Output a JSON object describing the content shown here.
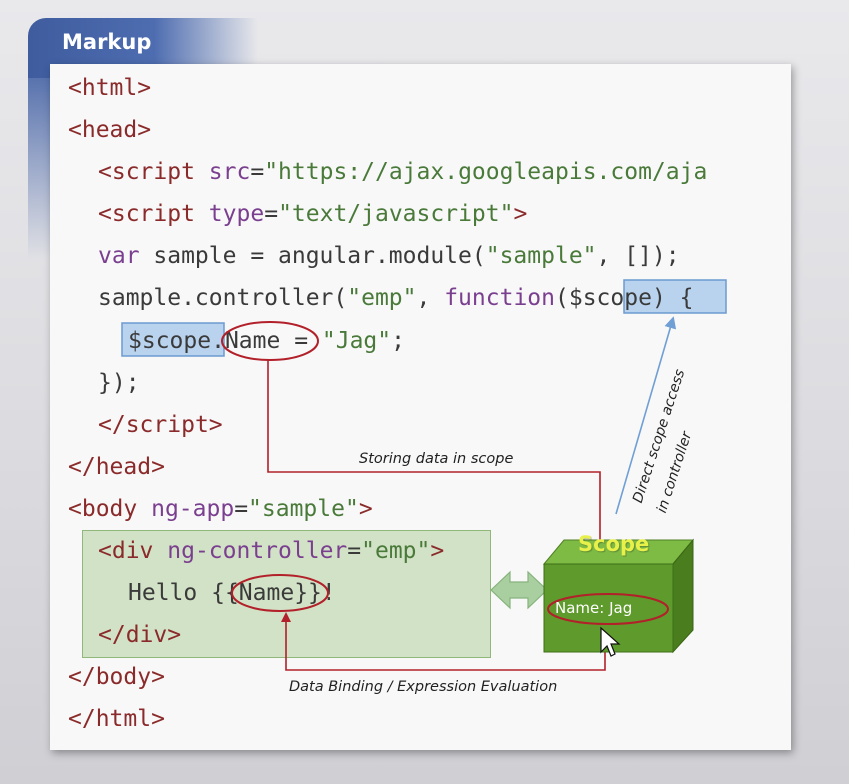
{
  "header": {
    "title": "Markup"
  },
  "code": {
    "l1": {
      "open": "<",
      "tag": "html",
      "close": ">"
    },
    "l2": {
      "open": "<",
      "tag": "head",
      "close": ">"
    },
    "l3": {
      "open": "<",
      "tag": "script",
      "attr": " src",
      "eq": "=",
      "val": "\"https://ajax.googleapis.com/aja"
    },
    "l4": {
      "open": "<",
      "tag": "script",
      "attr": " type",
      "eq": "=",
      "val": "\"text/javascript\"",
      "close": ">"
    },
    "l5": {
      "kw": "var",
      "rest1": " sample = angular.module(",
      "str": "\"sample\"",
      "rest2": ", []);"
    },
    "l6": {
      "a": "sample.controller(",
      "str": "\"emp\"",
      "b": ", ",
      "kw": "function",
      "c": "(",
      "param": "$scope",
      "d": ") {"
    },
    "l7": {
      "scope": "$scope",
      "dot": ".",
      "prop": "Name",
      "eq": " = ",
      "str": "\"Jag\"",
      "end": ";"
    },
    "l8": {
      "text": "});"
    },
    "l9": {
      "open": "</",
      "tag": "script",
      "close": ">"
    },
    "l10": {
      "open": "</",
      "tag": "head",
      "close": ">"
    },
    "l11": {
      "open": "<",
      "tag": "body",
      "attr": " ng-app",
      "eq": "=",
      "val": "\"sample\"",
      "close": ">"
    },
    "l12": {
      "open": "<",
      "tag": "div",
      "attr": " ng-controller",
      "eq": "=",
      "val": "\"emp\"",
      "close": ">"
    },
    "l13": {
      "a": "Hello ",
      "b": "{{",
      "expr": "Name",
      "c": "}}",
      "d": "!"
    },
    "l14": {
      "open": "</",
      "tag": "div",
      "close": ">"
    },
    "l15": {
      "open": "</",
      "tag": "body",
      "close": ">"
    },
    "l16": {
      "open": "</",
      "tag": "html",
      "close": ">"
    }
  },
  "annotations": {
    "storing": "Storing data in scope",
    "binding": "Data Binding / Expression Evaluation",
    "direct_line1": "Direct scope access",
    "direct_line2": "in controller"
  },
  "scope_box": {
    "title": "Scope",
    "value": "Name: Jag"
  },
  "colors": {
    "tag": "#8a2a2a",
    "keyword": "#7a3f8f",
    "string": "#4a7a3a",
    "highlight_fill": "#b9d3ef",
    "highlight_border": "#6a9ad0",
    "arrow_red": "#b2202a",
    "arrow_blue": "#6f9fd4",
    "scope_green": "#5e9a2c"
  }
}
